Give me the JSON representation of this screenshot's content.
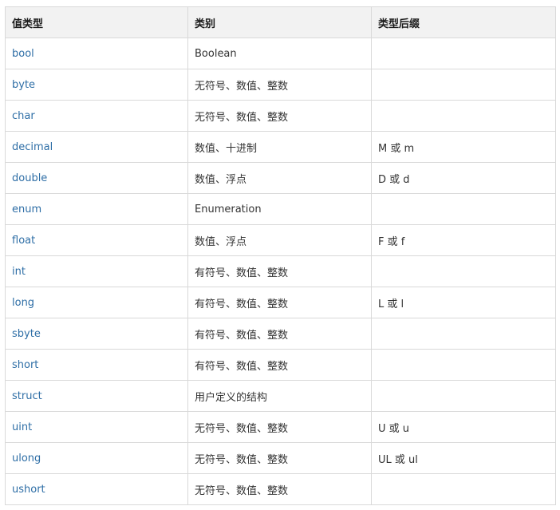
{
  "table": {
    "headers": [
      "值类型",
      "类别",
      "类型后缀"
    ],
    "rows": [
      {
        "type": "bool",
        "category": "Boolean",
        "suffix": ""
      },
      {
        "type": "byte",
        "category": "无符号、数值、整数",
        "suffix": ""
      },
      {
        "type": "char",
        "category": "无符号、数值、整数",
        "suffix": ""
      },
      {
        "type": "decimal",
        "category": "数值、十进制",
        "suffix": "M 或 m"
      },
      {
        "type": "double",
        "category": "数值、浮点",
        "suffix": "D 或 d"
      },
      {
        "type": "enum",
        "category": "Enumeration",
        "suffix": ""
      },
      {
        "type": "float",
        "category": "数值、浮点",
        "suffix": "F 或 f"
      },
      {
        "type": "int",
        "category": "有符号、数值、整数",
        "suffix": ""
      },
      {
        "type": "long",
        "category": "有符号、数值、整数",
        "suffix": "L 或 l"
      },
      {
        "type": "sbyte",
        "category": "有符号、数值、整数",
        "suffix": ""
      },
      {
        "type": "short",
        "category": "有符号、数值、整数",
        "suffix": ""
      },
      {
        "type": "struct",
        "category": "用户定义的结构",
        "suffix": ""
      },
      {
        "type": "uint",
        "category": "无符号、数值、整数",
        "suffix": "U 或 u"
      },
      {
        "type": "ulong",
        "category": "无符号、数值、整数",
        "suffix": "UL 或 ul"
      },
      {
        "type": "ushort",
        "category": "无符号、数值、整数",
        "suffix": ""
      }
    ]
  },
  "colors": {
    "header_bg": "#f2f2f2",
    "border": "#d9d9d9",
    "type_link": "#2e6ea6",
    "text": "#333333"
  }
}
